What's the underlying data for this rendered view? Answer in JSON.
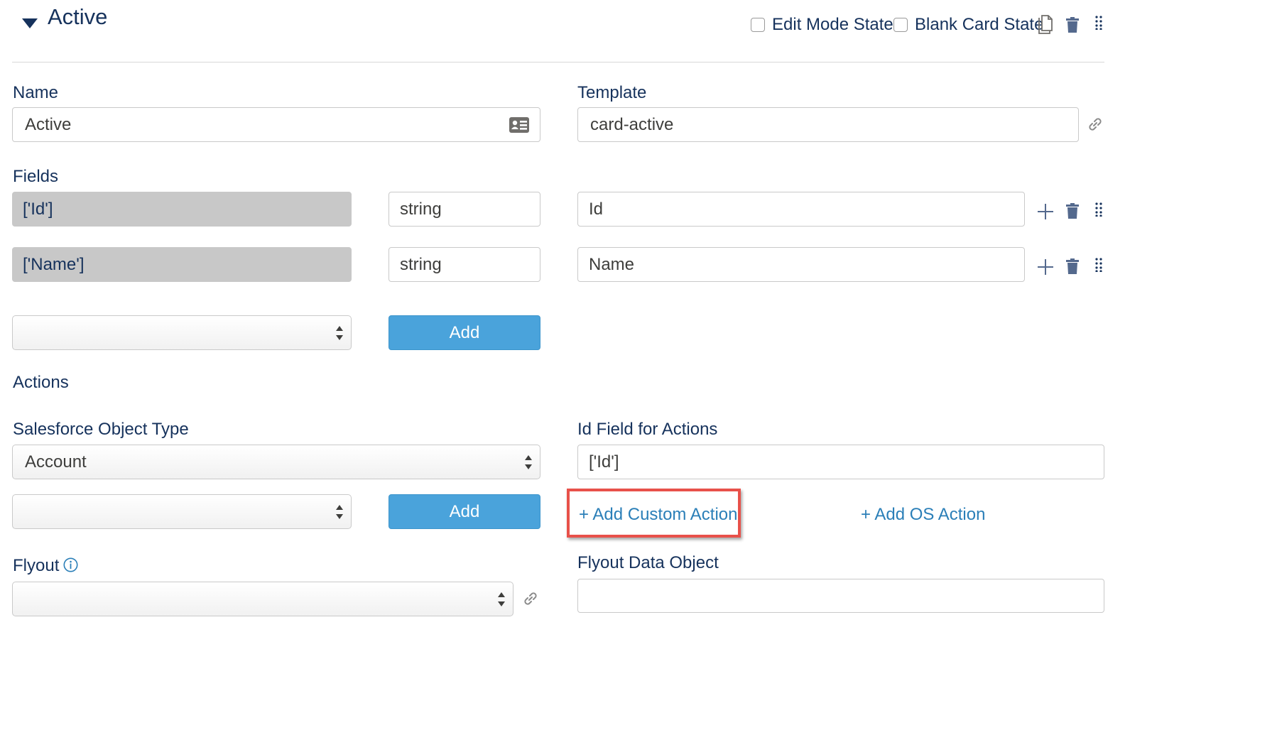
{
  "header": {
    "title": "Active",
    "edit_mode_label": "Edit Mode State",
    "blank_card_label": "Blank Card State"
  },
  "name_field": {
    "label": "Name",
    "value": "Active"
  },
  "template_field": {
    "label": "Template",
    "value": "card-active"
  },
  "fields": {
    "label": "Fields",
    "rows": [
      {
        "path": "['Id']",
        "type": "string",
        "label": "Id"
      },
      {
        "path": "['Name']",
        "type": "string",
        "label": "Name"
      }
    ],
    "add_label": "Add"
  },
  "actions": {
    "label": "Actions",
    "object_type_label": "Salesforce Object Type",
    "object_type_value": "Account",
    "id_field_label": "Id Field for Actions",
    "id_field_value": "['Id']",
    "add_label": "Add",
    "add_custom_action": "+ Add Custom Action",
    "add_os_action": "+ Add OS Action"
  },
  "flyout": {
    "label": "Flyout",
    "data_object_label": "Flyout Data Object"
  },
  "colors": {
    "accent_button": "#4aa3db",
    "link": "#2b7fb8",
    "highlight": "#e8514a"
  }
}
